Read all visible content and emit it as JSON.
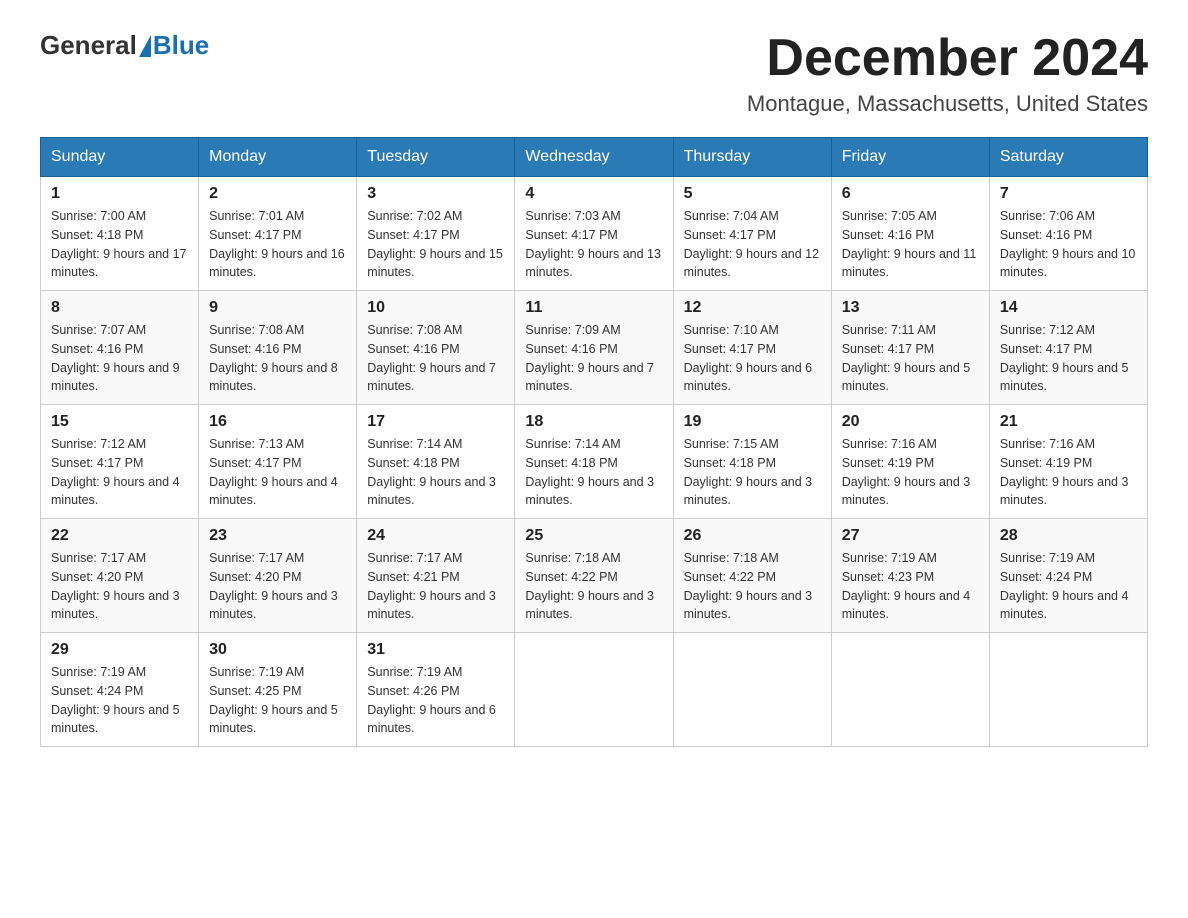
{
  "header": {
    "logo_general": "General",
    "logo_blue": "Blue",
    "month_title": "December 2024",
    "location": "Montague, Massachusetts, United States"
  },
  "weekdays": [
    "Sunday",
    "Monday",
    "Tuesday",
    "Wednesday",
    "Thursday",
    "Friday",
    "Saturday"
  ],
  "weeks": [
    [
      {
        "day": "1",
        "sunrise": "7:00 AM",
        "sunset": "4:18 PM",
        "daylight": "9 hours and 17 minutes."
      },
      {
        "day": "2",
        "sunrise": "7:01 AM",
        "sunset": "4:17 PM",
        "daylight": "9 hours and 16 minutes."
      },
      {
        "day": "3",
        "sunrise": "7:02 AM",
        "sunset": "4:17 PM",
        "daylight": "9 hours and 15 minutes."
      },
      {
        "day": "4",
        "sunrise": "7:03 AM",
        "sunset": "4:17 PM",
        "daylight": "9 hours and 13 minutes."
      },
      {
        "day": "5",
        "sunrise": "7:04 AM",
        "sunset": "4:17 PM",
        "daylight": "9 hours and 12 minutes."
      },
      {
        "day": "6",
        "sunrise": "7:05 AM",
        "sunset": "4:16 PM",
        "daylight": "9 hours and 11 minutes."
      },
      {
        "day": "7",
        "sunrise": "7:06 AM",
        "sunset": "4:16 PM",
        "daylight": "9 hours and 10 minutes."
      }
    ],
    [
      {
        "day": "8",
        "sunrise": "7:07 AM",
        "sunset": "4:16 PM",
        "daylight": "9 hours and 9 minutes."
      },
      {
        "day": "9",
        "sunrise": "7:08 AM",
        "sunset": "4:16 PM",
        "daylight": "9 hours and 8 minutes."
      },
      {
        "day": "10",
        "sunrise": "7:08 AM",
        "sunset": "4:16 PM",
        "daylight": "9 hours and 7 minutes."
      },
      {
        "day": "11",
        "sunrise": "7:09 AM",
        "sunset": "4:16 PM",
        "daylight": "9 hours and 7 minutes."
      },
      {
        "day": "12",
        "sunrise": "7:10 AM",
        "sunset": "4:17 PM",
        "daylight": "9 hours and 6 minutes."
      },
      {
        "day": "13",
        "sunrise": "7:11 AM",
        "sunset": "4:17 PM",
        "daylight": "9 hours and 5 minutes."
      },
      {
        "day": "14",
        "sunrise": "7:12 AM",
        "sunset": "4:17 PM",
        "daylight": "9 hours and 5 minutes."
      }
    ],
    [
      {
        "day": "15",
        "sunrise": "7:12 AM",
        "sunset": "4:17 PM",
        "daylight": "9 hours and 4 minutes."
      },
      {
        "day": "16",
        "sunrise": "7:13 AM",
        "sunset": "4:17 PM",
        "daylight": "9 hours and 4 minutes."
      },
      {
        "day": "17",
        "sunrise": "7:14 AM",
        "sunset": "4:18 PM",
        "daylight": "9 hours and 3 minutes."
      },
      {
        "day": "18",
        "sunrise": "7:14 AM",
        "sunset": "4:18 PM",
        "daylight": "9 hours and 3 minutes."
      },
      {
        "day": "19",
        "sunrise": "7:15 AM",
        "sunset": "4:18 PM",
        "daylight": "9 hours and 3 minutes."
      },
      {
        "day": "20",
        "sunrise": "7:16 AM",
        "sunset": "4:19 PM",
        "daylight": "9 hours and 3 minutes."
      },
      {
        "day": "21",
        "sunrise": "7:16 AM",
        "sunset": "4:19 PM",
        "daylight": "9 hours and 3 minutes."
      }
    ],
    [
      {
        "day": "22",
        "sunrise": "7:17 AM",
        "sunset": "4:20 PM",
        "daylight": "9 hours and 3 minutes."
      },
      {
        "day": "23",
        "sunrise": "7:17 AM",
        "sunset": "4:20 PM",
        "daylight": "9 hours and 3 minutes."
      },
      {
        "day": "24",
        "sunrise": "7:17 AM",
        "sunset": "4:21 PM",
        "daylight": "9 hours and 3 minutes."
      },
      {
        "day": "25",
        "sunrise": "7:18 AM",
        "sunset": "4:22 PM",
        "daylight": "9 hours and 3 minutes."
      },
      {
        "day": "26",
        "sunrise": "7:18 AM",
        "sunset": "4:22 PM",
        "daylight": "9 hours and 3 minutes."
      },
      {
        "day": "27",
        "sunrise": "7:19 AM",
        "sunset": "4:23 PM",
        "daylight": "9 hours and 4 minutes."
      },
      {
        "day": "28",
        "sunrise": "7:19 AM",
        "sunset": "4:24 PM",
        "daylight": "9 hours and 4 minutes."
      }
    ],
    [
      {
        "day": "29",
        "sunrise": "7:19 AM",
        "sunset": "4:24 PM",
        "daylight": "9 hours and 5 minutes."
      },
      {
        "day": "30",
        "sunrise": "7:19 AM",
        "sunset": "4:25 PM",
        "daylight": "9 hours and 5 minutes."
      },
      {
        "day": "31",
        "sunrise": "7:19 AM",
        "sunset": "4:26 PM",
        "daylight": "9 hours and 6 minutes."
      },
      null,
      null,
      null,
      null
    ]
  ],
  "labels": {
    "sunrise_prefix": "Sunrise: ",
    "sunset_prefix": "Sunset: ",
    "daylight_prefix": "Daylight: "
  }
}
